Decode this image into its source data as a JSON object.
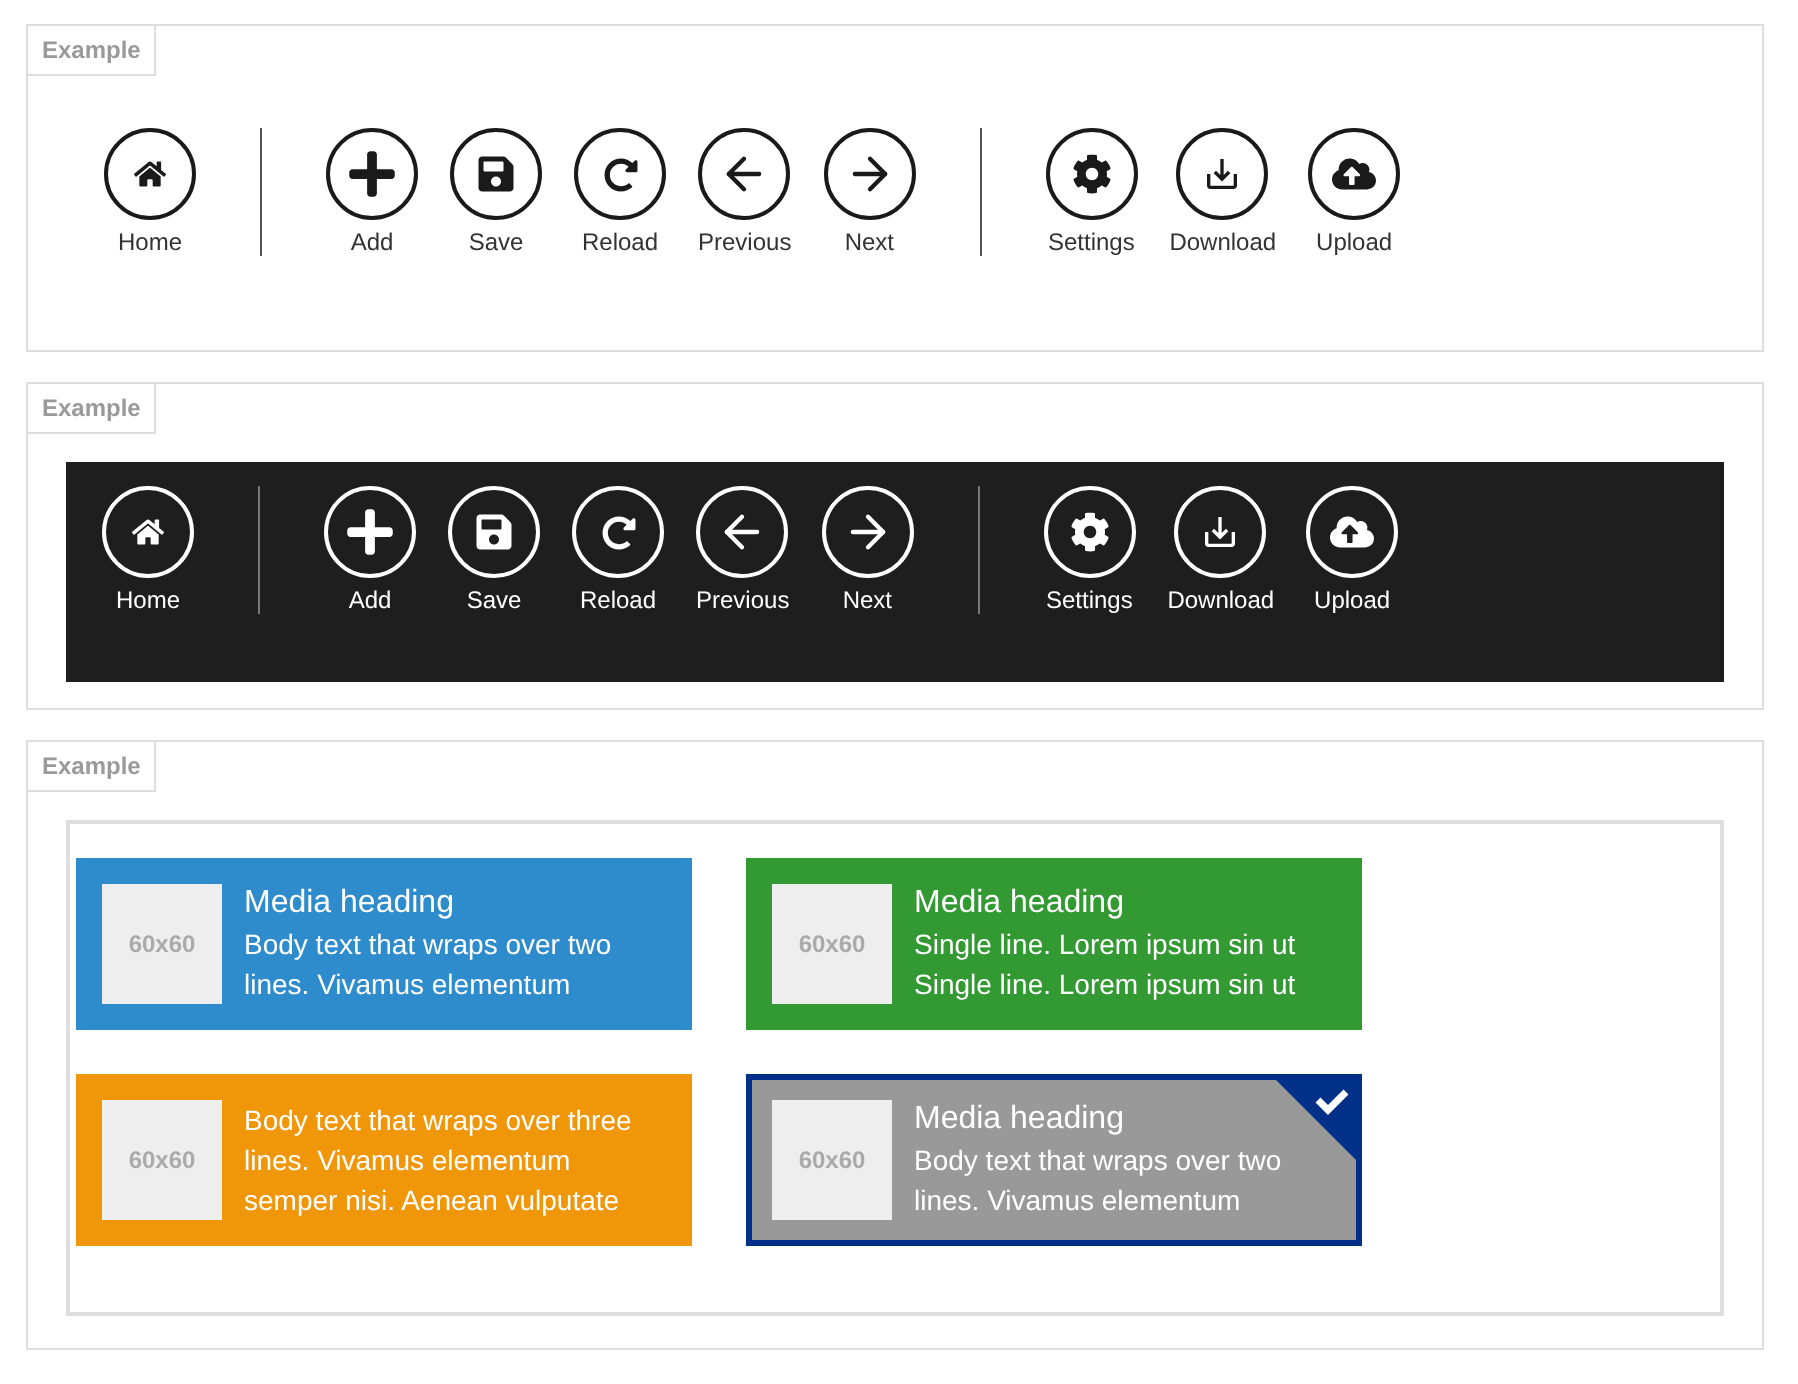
{
  "panels": [
    {
      "kind": "toolbar",
      "label": "Example",
      "dark": false,
      "groups": [
        [
          {
            "label": "Home"
          }
        ],
        [
          {
            "label": "Add"
          },
          {
            "label": "Save"
          },
          {
            "label": "Reload"
          },
          {
            "label": "Previous"
          },
          {
            "label": "Next"
          }
        ],
        [
          {
            "label": "Settings"
          },
          {
            "label": "Download"
          },
          {
            "label": "Upload"
          }
        ]
      ]
    },
    {
      "kind": "toolbar",
      "label": "Example",
      "dark": true,
      "groups": [
        [
          {
            "label": "Home"
          }
        ],
        [
          {
            "label": "Add"
          },
          {
            "label": "Save"
          },
          {
            "label": "Reload"
          },
          {
            "label": "Previous"
          },
          {
            "label": "Next"
          }
        ],
        [
          {
            "label": "Settings"
          },
          {
            "label": "Download"
          },
          {
            "label": "Upload"
          }
        ]
      ]
    },
    {
      "kind": "tiles",
      "label": "Example",
      "tiles": [
        {
          "color": "#2e8bcc",
          "thumb": "60x60",
          "heading": "Media heading",
          "lines": [
            "Body text that wraps over two",
            "lines. Vivamus elementum"
          ],
          "selected": false
        },
        {
          "color": "#339933",
          "thumb": "60x60",
          "heading": "Media heading",
          "lines": [
            "Single line. Lorem ipsum sin ut",
            "Single line. Lorem ipsum sin ut"
          ],
          "selected": false
        },
        {
          "color": "#f09609",
          "thumb": "60x60",
          "lines": [
            "Body text that wraps over three",
            "lines. Vivamus elementum",
            "semper nisi. Aenean vulputate"
          ],
          "selected": false
        },
        {
          "color": "#999999",
          "thumb": "60x60",
          "heading": "Media heading",
          "lines": [
            "Body text that wraps over two",
            "lines. Vivamus elementum"
          ],
          "selected": true
        }
      ]
    }
  ]
}
